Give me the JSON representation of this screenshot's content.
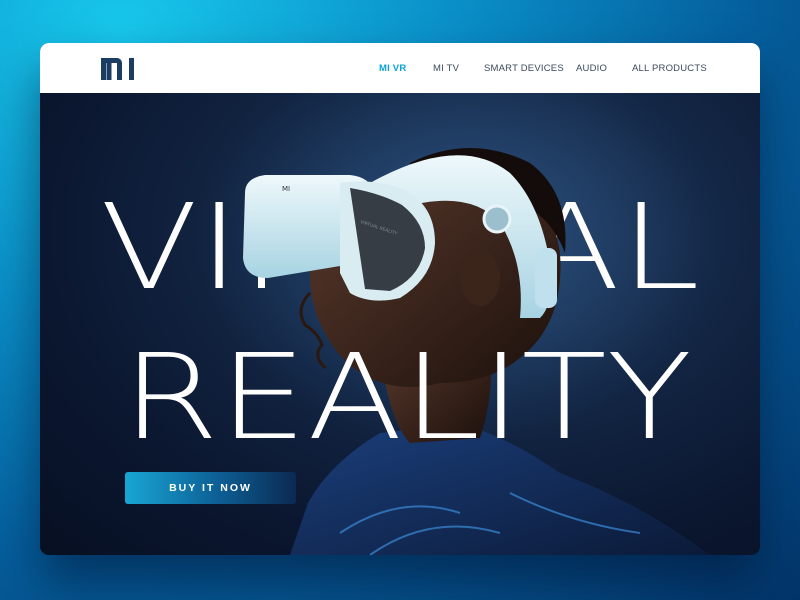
{
  "brand": {
    "logo_text": "MI"
  },
  "nav": {
    "items": [
      {
        "label": "MI VR",
        "active": true
      },
      {
        "label": "MI TV",
        "active": false
      },
      {
        "label": "SMART DEVICES",
        "active": false
      },
      {
        "label": "AUDIO",
        "active": false
      },
      {
        "label": "ALL PRODUCTS",
        "active": false
      }
    ]
  },
  "hero": {
    "headline_line1": "VIRTUAL",
    "headline_line2": "REALITY",
    "headset_brand": "MI",
    "headset_label": "VIRTUAL REALITY",
    "cta_label": "BUY IT NOW"
  },
  "colors": {
    "accent": "#0aa2d6",
    "nav_text": "#3b4a5c",
    "hero_background": "#0d1930",
    "page_background": "#0a8fc8"
  }
}
